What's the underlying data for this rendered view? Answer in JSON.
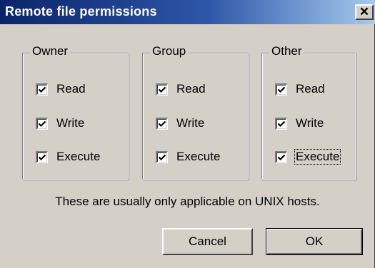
{
  "window": {
    "title": "Remote file permissions",
    "close_glyph": "✕"
  },
  "groups": [
    {
      "label": "Owner",
      "items": [
        {
          "label": "Read",
          "checked": true
        },
        {
          "label": "Write",
          "checked": true
        },
        {
          "label": "Execute",
          "checked": true
        }
      ]
    },
    {
      "label": "Group",
      "items": [
        {
          "label": "Read",
          "checked": true
        },
        {
          "label": "Write",
          "checked": true
        },
        {
          "label": "Execute",
          "checked": true
        }
      ]
    },
    {
      "label": "Other",
      "items": [
        {
          "label": "Read",
          "checked": true
        },
        {
          "label": "Write",
          "checked": true
        },
        {
          "label": "Execute",
          "checked": true,
          "focused": true
        }
      ]
    }
  ],
  "hint": "These are usually only applicable on UNIX hosts.",
  "buttons": {
    "cancel": "Cancel",
    "ok": "OK"
  },
  "colors": {
    "face": "#d4d0c8",
    "title_start": "#0a246a",
    "title_end": "#a6caf0",
    "title_text": "#ffffff"
  },
  "icons": {
    "check": "checkmark-icon",
    "close": "close-icon"
  }
}
